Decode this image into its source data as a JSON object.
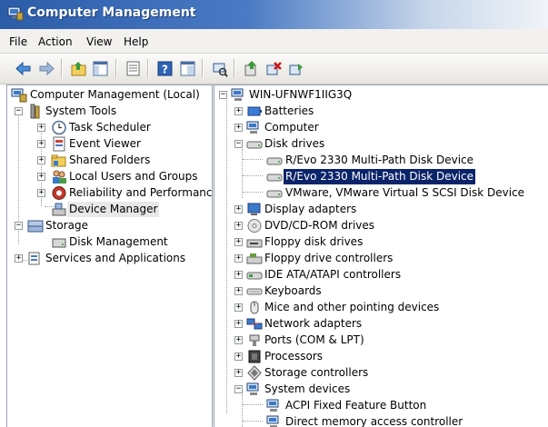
{
  "window": {
    "title": "Computer Management"
  },
  "menu": {
    "file": "File",
    "action": "Action",
    "view": "View",
    "help": "Help"
  },
  "toolbar": {
    "icons": [
      "back-arrow-icon",
      "forward-arrow-icon",
      "up-folder-icon",
      "show-hide-tree-icon",
      "properties-icon",
      "help-icon",
      "help-topic-icon",
      "scan-hardware-icon",
      "update-driver-icon",
      "uninstall-icon",
      "enable-device-icon"
    ]
  },
  "left_tree": {
    "root": "Computer Management (Local)",
    "system_tools": "System Tools",
    "task_scheduler": "Task Scheduler",
    "event_viewer": "Event Viewer",
    "shared_folders": "Shared Folders",
    "local_users": "Local Users and Groups",
    "reliability": "Reliability and Performanc",
    "device_manager": "Device Manager",
    "storage": "Storage",
    "disk_management": "Disk Management",
    "services": "Services and Applications"
  },
  "right_tree": {
    "root": "WIN-UFNWF1IIG3Q",
    "batteries": "Batteries",
    "computer": "Computer",
    "disk_drives": "Disk drives",
    "disk_1": "R/Evo 2330 Multi-Path Disk Device",
    "disk_2": "R/Evo 2330 Multi-Path Disk Device",
    "disk_3": "VMware, VMware Virtual S SCSI Disk Device",
    "display_adapters": "Display adapters",
    "dvd": "DVD/CD-ROM drives",
    "floppy_disk": "Floppy disk drives",
    "floppy_ctrl": "Floppy drive controllers",
    "ide": "IDE ATA/ATAPI controllers",
    "keyboards": "Keyboards",
    "mice": "Mice and other pointing devices",
    "network": "Network adapters",
    "ports": "Ports (COM & LPT)",
    "processors": "Processors",
    "storage_ctrl": "Storage controllers",
    "system_devices": "System devices",
    "acpi": "ACPI Fixed Feature Button",
    "dma": "Direct memory access controller"
  },
  "expander": {
    "plus": "+",
    "minus": "−"
  },
  "colors": {
    "selection": "#0a246a",
    "title_start": "#2b5ca8",
    "title_end": "#f1f4f8"
  }
}
